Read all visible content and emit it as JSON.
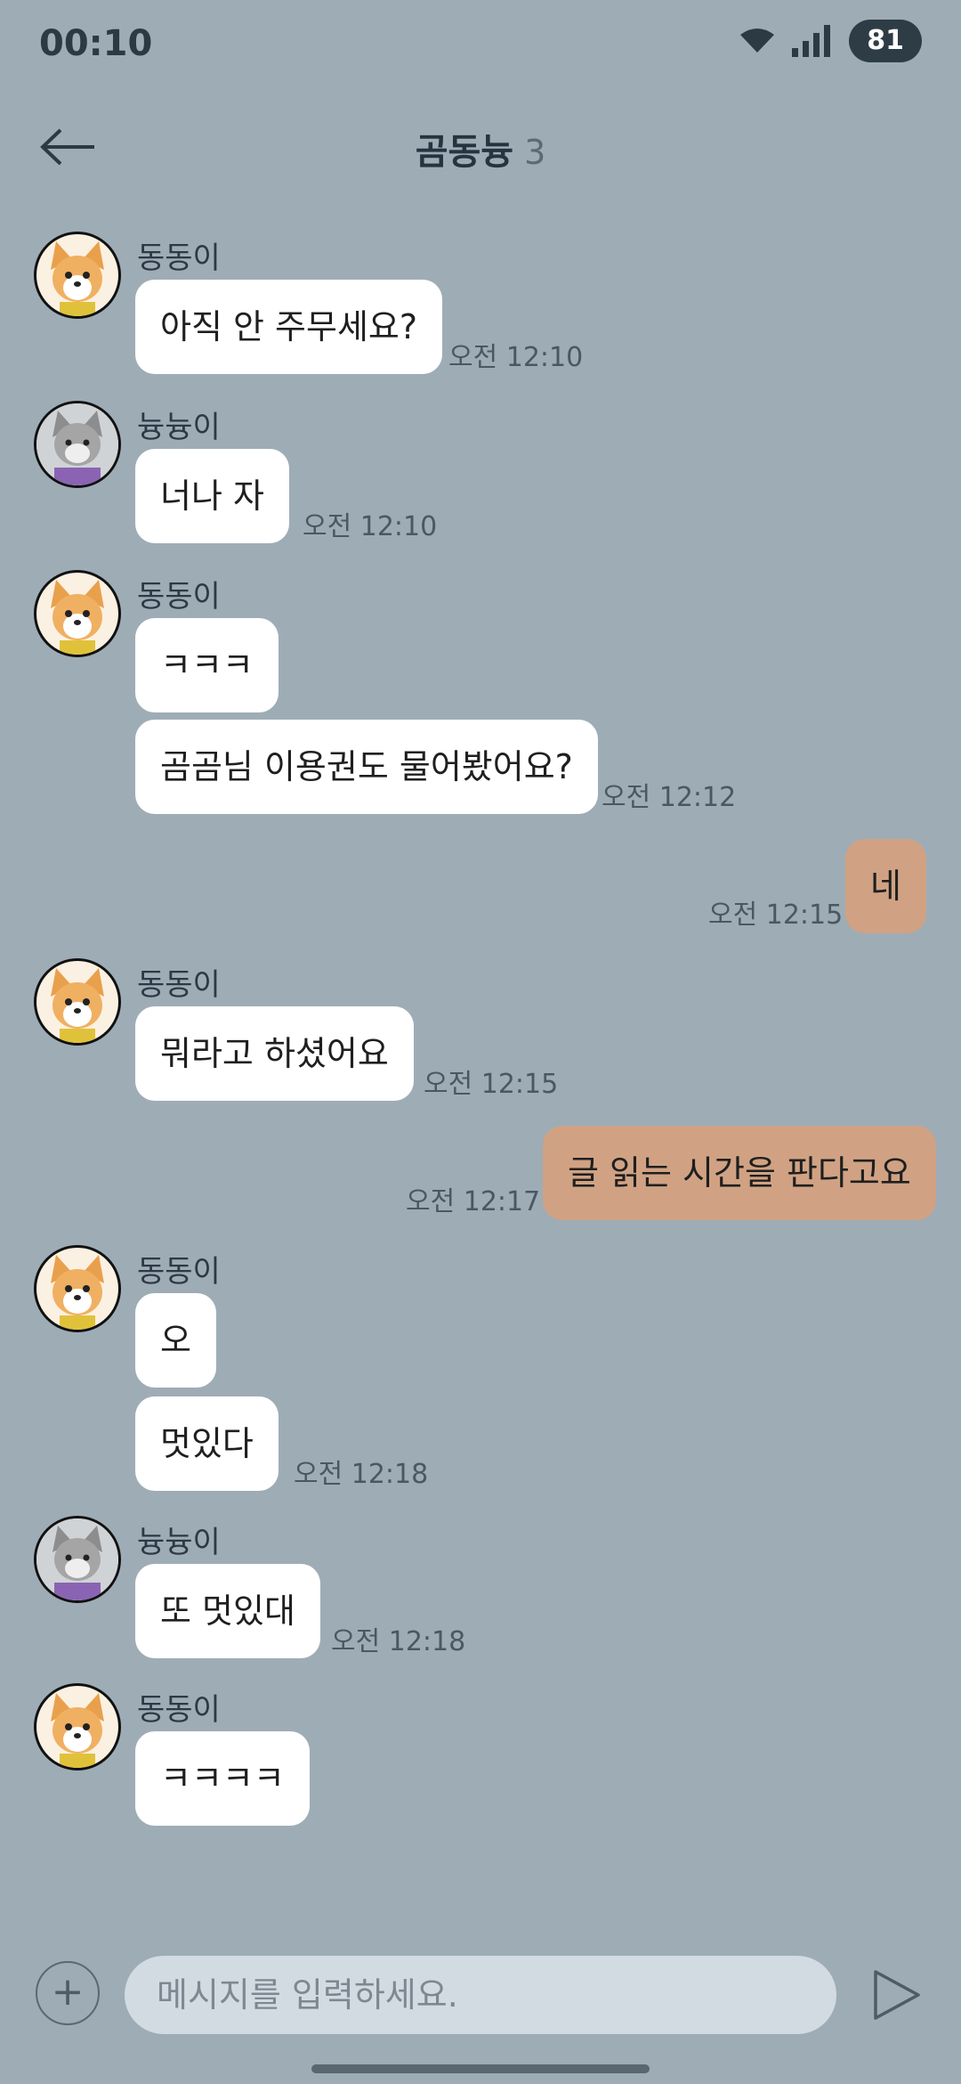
{
  "status": {
    "time": "00:10",
    "battery": "81"
  },
  "header": {
    "title": "곰동늉",
    "member_count": "3"
  },
  "senders": {
    "dong": "동동이",
    "nyung": "늉늉이"
  },
  "messages": {
    "m1": {
      "text": "아직 안 주무세요?",
      "time": "오전 12:10"
    },
    "m2": {
      "text": "너나 자",
      "time": "오전 12:10"
    },
    "m3a": {
      "text": "ㅋㅋㅋ"
    },
    "m3b": {
      "text": "곰곰님 이용권도 물어봤어요?",
      "time": "오전 12:12"
    },
    "m4": {
      "text": "네",
      "time": "오전 12:15"
    },
    "m5": {
      "text": "뭐라고 하셨어요",
      "time": "오전 12:15"
    },
    "m6": {
      "text": "글 읽는 시간을 판다고요",
      "time": "오전 12:17"
    },
    "m7a": {
      "text": "오"
    },
    "m7b": {
      "text": "멋있다",
      "time": "오전 12:18"
    },
    "m8": {
      "text": "또 멋있대",
      "time": "오전 12:18"
    },
    "m9": {
      "text": "ㅋㅋㅋㅋ"
    }
  },
  "input": {
    "placeholder": "메시지를 입력하세요."
  },
  "colors": {
    "background": "#9eacb6",
    "my_bubble": "#d0a283",
    "other_bubble": "#ffffff"
  },
  "icons": {
    "back": "arrow-left-icon",
    "add": "plus-icon",
    "send": "send-icon",
    "wifi": "wifi-icon",
    "signal": "signal-icon"
  }
}
